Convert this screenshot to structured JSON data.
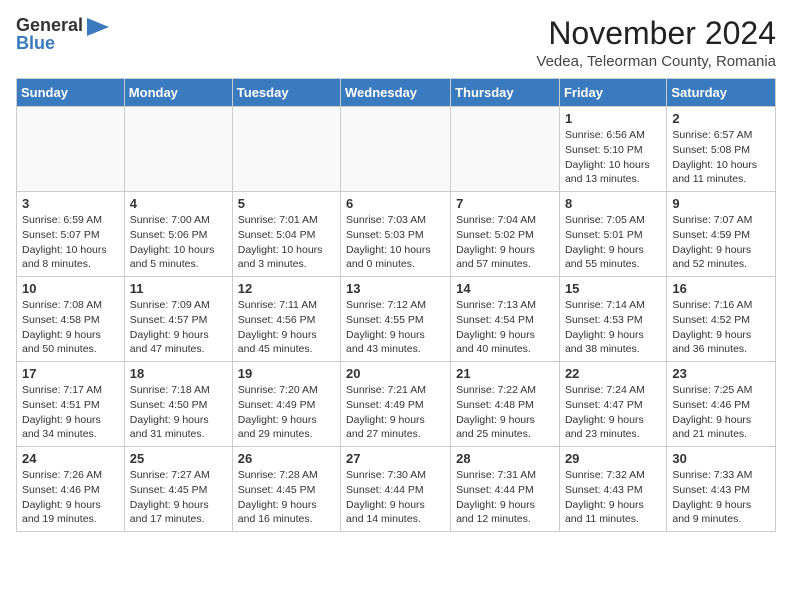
{
  "logo": {
    "general": "General",
    "blue": "Blue",
    "arrow_unicode": "▶"
  },
  "header": {
    "month_title": "November 2024",
    "location": "Vedea, Teleorman County, Romania"
  },
  "weekdays": [
    "Sunday",
    "Monday",
    "Tuesday",
    "Wednesday",
    "Thursday",
    "Friday",
    "Saturday"
  ],
  "weeks": [
    [
      {
        "day": "",
        "info": ""
      },
      {
        "day": "",
        "info": ""
      },
      {
        "day": "",
        "info": ""
      },
      {
        "day": "",
        "info": ""
      },
      {
        "day": "",
        "info": ""
      },
      {
        "day": "1",
        "info": "Sunrise: 6:56 AM\nSunset: 5:10 PM\nDaylight: 10 hours and 13 minutes."
      },
      {
        "day": "2",
        "info": "Sunrise: 6:57 AM\nSunset: 5:08 PM\nDaylight: 10 hours and 11 minutes."
      }
    ],
    [
      {
        "day": "3",
        "info": "Sunrise: 6:59 AM\nSunset: 5:07 PM\nDaylight: 10 hours and 8 minutes."
      },
      {
        "day": "4",
        "info": "Sunrise: 7:00 AM\nSunset: 5:06 PM\nDaylight: 10 hours and 5 minutes."
      },
      {
        "day": "5",
        "info": "Sunrise: 7:01 AM\nSunset: 5:04 PM\nDaylight: 10 hours and 3 minutes."
      },
      {
        "day": "6",
        "info": "Sunrise: 7:03 AM\nSunset: 5:03 PM\nDaylight: 10 hours and 0 minutes."
      },
      {
        "day": "7",
        "info": "Sunrise: 7:04 AM\nSunset: 5:02 PM\nDaylight: 9 hours and 57 minutes."
      },
      {
        "day": "8",
        "info": "Sunrise: 7:05 AM\nSunset: 5:01 PM\nDaylight: 9 hours and 55 minutes."
      },
      {
        "day": "9",
        "info": "Sunrise: 7:07 AM\nSunset: 4:59 PM\nDaylight: 9 hours and 52 minutes."
      }
    ],
    [
      {
        "day": "10",
        "info": "Sunrise: 7:08 AM\nSunset: 4:58 PM\nDaylight: 9 hours and 50 minutes."
      },
      {
        "day": "11",
        "info": "Sunrise: 7:09 AM\nSunset: 4:57 PM\nDaylight: 9 hours and 47 minutes."
      },
      {
        "day": "12",
        "info": "Sunrise: 7:11 AM\nSunset: 4:56 PM\nDaylight: 9 hours and 45 minutes."
      },
      {
        "day": "13",
        "info": "Sunrise: 7:12 AM\nSunset: 4:55 PM\nDaylight: 9 hours and 43 minutes."
      },
      {
        "day": "14",
        "info": "Sunrise: 7:13 AM\nSunset: 4:54 PM\nDaylight: 9 hours and 40 minutes."
      },
      {
        "day": "15",
        "info": "Sunrise: 7:14 AM\nSunset: 4:53 PM\nDaylight: 9 hours and 38 minutes."
      },
      {
        "day": "16",
        "info": "Sunrise: 7:16 AM\nSunset: 4:52 PM\nDaylight: 9 hours and 36 minutes."
      }
    ],
    [
      {
        "day": "17",
        "info": "Sunrise: 7:17 AM\nSunset: 4:51 PM\nDaylight: 9 hours and 34 minutes."
      },
      {
        "day": "18",
        "info": "Sunrise: 7:18 AM\nSunset: 4:50 PM\nDaylight: 9 hours and 31 minutes."
      },
      {
        "day": "19",
        "info": "Sunrise: 7:20 AM\nSunset: 4:49 PM\nDaylight: 9 hours and 29 minutes."
      },
      {
        "day": "20",
        "info": "Sunrise: 7:21 AM\nSunset: 4:49 PM\nDaylight: 9 hours and 27 minutes."
      },
      {
        "day": "21",
        "info": "Sunrise: 7:22 AM\nSunset: 4:48 PM\nDaylight: 9 hours and 25 minutes."
      },
      {
        "day": "22",
        "info": "Sunrise: 7:24 AM\nSunset: 4:47 PM\nDaylight: 9 hours and 23 minutes."
      },
      {
        "day": "23",
        "info": "Sunrise: 7:25 AM\nSunset: 4:46 PM\nDaylight: 9 hours and 21 minutes."
      }
    ],
    [
      {
        "day": "24",
        "info": "Sunrise: 7:26 AM\nSunset: 4:46 PM\nDaylight: 9 hours and 19 minutes."
      },
      {
        "day": "25",
        "info": "Sunrise: 7:27 AM\nSunset: 4:45 PM\nDaylight: 9 hours and 17 minutes."
      },
      {
        "day": "26",
        "info": "Sunrise: 7:28 AM\nSunset: 4:45 PM\nDaylight: 9 hours and 16 minutes."
      },
      {
        "day": "27",
        "info": "Sunrise: 7:30 AM\nSunset: 4:44 PM\nDaylight: 9 hours and 14 minutes."
      },
      {
        "day": "28",
        "info": "Sunrise: 7:31 AM\nSunset: 4:44 PM\nDaylight: 9 hours and 12 minutes."
      },
      {
        "day": "29",
        "info": "Sunrise: 7:32 AM\nSunset: 4:43 PM\nDaylight: 9 hours and 11 minutes."
      },
      {
        "day": "30",
        "info": "Sunrise: 7:33 AM\nSunset: 4:43 PM\nDaylight: 9 hours and 9 minutes."
      }
    ]
  ]
}
